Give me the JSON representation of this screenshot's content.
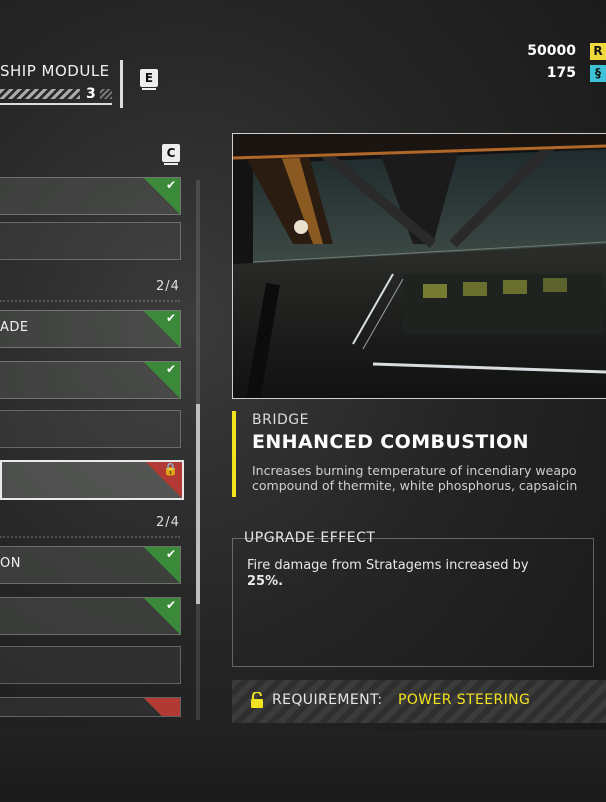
{
  "header": {
    "title": "SHIP MODULE",
    "level": "3",
    "key_next": "E",
    "key_list": "C"
  },
  "currency": {
    "req_value": "50000",
    "req_badge": "R",
    "req_color": "#f0d93a",
    "samples_value": "175",
    "samples_badge": "§",
    "samples_color": "#3cc3d8"
  },
  "list": {
    "group1_count": "2/4",
    "group2_count": "2/4",
    "rows": [
      {
        "label": "",
        "status": "unlocked"
      },
      {
        "label": "",
        "status": "none"
      },
      {
        "label": "ADE",
        "status": "unlocked"
      },
      {
        "label": "",
        "status": "unlocked"
      },
      {
        "label": "",
        "status": "none"
      },
      {
        "label": "",
        "status": "locked"
      },
      {
        "label": "ON",
        "status": "unlocked"
      },
      {
        "label": "",
        "status": "unlocked"
      },
      {
        "label": "",
        "status": "none"
      },
      {
        "label": "",
        "status": "locked"
      }
    ]
  },
  "detail": {
    "category": "BRIDGE",
    "title": "ENHANCED COMBUSTION",
    "description_line1": "Increases burning temperature of incendiary weapo",
    "description_line2": "compound of thermite, white phosphorus, capsaicin",
    "effect_label": "UPGRADE EFFECT",
    "effect_text": "Fire damage from Stratagems increased by",
    "effect_value": "25%.",
    "requirement_label": "REQUIREMENT:",
    "requirement_value": "POWER STEERING",
    "accent_color": "#f3e21e"
  }
}
